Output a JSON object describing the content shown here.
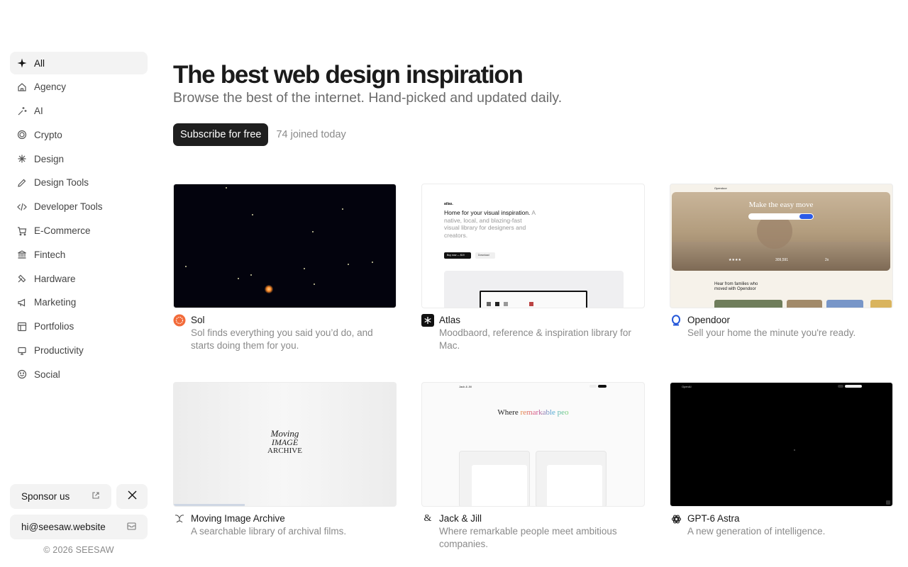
{
  "sidebar": {
    "items": [
      {
        "label": "All",
        "icon": "sparkle-icon",
        "active": true
      },
      {
        "label": "Agency",
        "icon": "home-icon"
      },
      {
        "label": "AI",
        "icon": "wand-icon"
      },
      {
        "label": "Crypto",
        "icon": "coin-icon"
      },
      {
        "label": "Design",
        "icon": "asterisk-icon"
      },
      {
        "label": "Design Tools",
        "icon": "pencil-icon"
      },
      {
        "label": "Developer Tools",
        "icon": "code-icon"
      },
      {
        "label": "E-Commerce",
        "icon": "cart-icon"
      },
      {
        "label": "Fintech",
        "icon": "bank-icon"
      },
      {
        "label": "Hardware",
        "icon": "tools-icon"
      },
      {
        "label": "Marketing",
        "icon": "megaphone-icon"
      },
      {
        "label": "Portfolios",
        "icon": "layout-icon"
      },
      {
        "label": "Productivity",
        "icon": "monitor-icon"
      },
      {
        "label": "Social",
        "icon": "smile-icon"
      }
    ],
    "sponsor_label": "Sponsor us",
    "email": "hi@seesaw.website",
    "copyright": "© 2026 SEESAW"
  },
  "hero": {
    "title": "The best web design inspiration",
    "subtitle": "Browse the best of the internet. Hand-picked and updated daily.",
    "subscribe_label": "Subscribe for free",
    "joined_text": "74 joined today"
  },
  "cards": [
    {
      "name": "Sol",
      "desc": "Sol finds everything you said you’d do, and starts doing them for you.",
      "icon": "sol-logo-icon"
    },
    {
      "name": "Atlas",
      "desc": "Moodbaord, reference & inspiration library for Mac.",
      "icon": "atlas-logo-icon",
      "thumb": {
        "brand": "atlas.",
        "headline": "Home for your visual inspiration.",
        "tagline": "A native, local, and blazing-fast visual library for designers and creators.",
        "buy": "Buy now — $19",
        "download": "Download"
      }
    },
    {
      "name": "Opendoor",
      "desc": "Sell your home the minute you're ready.",
      "icon": "opendoor-logo-icon",
      "thumb": {
        "brand": "Opendoor",
        "headline": "Make the easy move",
        "stat1": "★★★★",
        "stat2": "309,591",
        "stat3": "2x",
        "families": "Hear from families who moved with Opendoor"
      }
    },
    {
      "name": "Moving Image Archive",
      "desc": "A searchable library of archival films.",
      "icon": "mia-logo-icon",
      "thumb": {
        "line1": "Moving",
        "line2": "Image",
        "line3": "Archive"
      }
    },
    {
      "name": "Jack & Jill",
      "desc": "Where remarkable people meet ambitious companies.",
      "icon": "ampersand-icon",
      "thumb": {
        "brand": "Jack & Jill",
        "headline_a": "Where ",
        "headline_b": "remarkable peo"
      }
    },
    {
      "name": "GPT-6 Astra",
      "desc": "A new generation of intelligence.",
      "icon": "openai-logo-icon",
      "thumb": {
        "brand": "OpenAI"
      }
    }
  ]
}
